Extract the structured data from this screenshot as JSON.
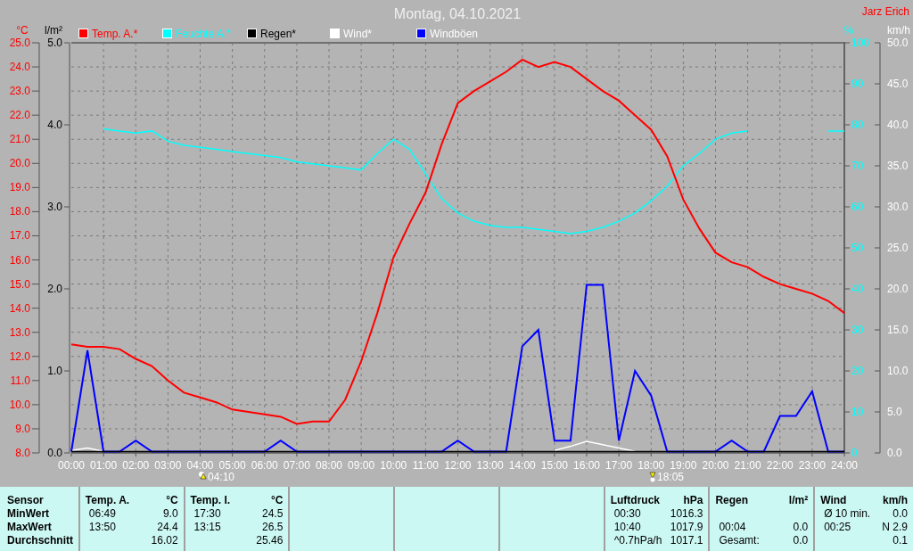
{
  "header": {
    "author": "Jarz Erich"
  },
  "chart": {
    "chart_data": {
      "type": "line",
      "title": "Montag, 04.10.2021",
      "legend": "top",
      "grid": true,
      "x": [
        0,
        0.5,
        1,
        1.5,
        2,
        2.5,
        3,
        3.5,
        4,
        4.5,
        5,
        5.5,
        6,
        6.5,
        7,
        7.5,
        8,
        8.5,
        9,
        9.5,
        10,
        10.5,
        11,
        11.5,
        12,
        12.5,
        13,
        13.5,
        14,
        14.5,
        15,
        15.5,
        16,
        16.5,
        17,
        17.5,
        18,
        18.5,
        19,
        19.5,
        20,
        20.5,
        21,
        21.5,
        22,
        22.5,
        23,
        23.5,
        24
      ],
      "xlim": [
        0,
        24
      ],
      "xticks": [
        {
          "value": 0,
          "label": "00:00"
        },
        {
          "value": 1,
          "label": "01:00"
        },
        {
          "value": 2,
          "label": "02:00"
        },
        {
          "value": 3,
          "label": "03:00"
        },
        {
          "value": 4,
          "label": "04:00"
        },
        {
          "value": 5,
          "label": "05:00"
        },
        {
          "value": 6,
          "label": "06:00"
        },
        {
          "value": 7,
          "label": "07:00"
        },
        {
          "value": 8,
          "label": "08:00"
        },
        {
          "value": 9,
          "label": "09:00"
        },
        {
          "value": 10,
          "label": "10:00"
        },
        {
          "value": 11,
          "label": "11:00"
        },
        {
          "value": 12,
          "label": "12:00"
        },
        {
          "value": 13,
          "label": "13:00"
        },
        {
          "value": 14,
          "label": "14:00"
        },
        {
          "value": 15,
          "label": "15:00"
        },
        {
          "value": 16,
          "label": "16:00"
        },
        {
          "value": 17,
          "label": "17:00"
        },
        {
          "value": 18,
          "label": "18:00"
        },
        {
          "value": 19,
          "label": "19:00"
        },
        {
          "value": 20,
          "label": "20:00"
        },
        {
          "value": 21,
          "label": "21:00"
        },
        {
          "value": 22,
          "label": "22:00"
        },
        {
          "value": 23,
          "label": "23:00"
        },
        {
          "value": 24,
          "label": "24:00"
        }
      ],
      "ylabel": "°C",
      "ylim": [
        8,
        25
      ],
      "yticks": [
        {
          "value": 8,
          "label": "8.0"
        },
        {
          "value": 9,
          "label": "9.0"
        },
        {
          "value": 10,
          "label": "10.0"
        },
        {
          "value": 11,
          "label": "11.0"
        },
        {
          "value": 12,
          "label": "12.0"
        },
        {
          "value": 13,
          "label": "13.0"
        },
        {
          "value": 14,
          "label": "14.0"
        },
        {
          "value": 15,
          "label": "15.0"
        },
        {
          "value": 16,
          "label": "16.0"
        },
        {
          "value": 17,
          "label": "17.0"
        },
        {
          "value": 18,
          "label": "18.0"
        },
        {
          "value": 19,
          "label": "19.0"
        },
        {
          "value": 20,
          "label": "20.0"
        },
        {
          "value": 21,
          "label": "21.0"
        },
        {
          "value": 22,
          "label": "22.0"
        },
        {
          "value": 23,
          "label": "23.0"
        },
        {
          "value": 24,
          "label": "24.0"
        },
        {
          "value": 25,
          "label": "25.0"
        }
      ],
      "y2label": "%",
      "y2lim": [
        0,
        100
      ],
      "y2ticks": [
        0,
        10,
        20,
        30,
        40,
        50,
        60,
        70,
        80,
        90,
        100
      ],
      "y3label": "km/h",
      "y3lim": [
        0,
        50
      ],
      "y3ticks": [
        {
          "value": 0,
          "label": "0.0"
        },
        {
          "value": 5,
          "label": "5.0"
        },
        {
          "value": 10,
          "label": "10.0"
        },
        {
          "value": 15,
          "label": "15.0"
        },
        {
          "value": 20,
          "label": "20.0"
        },
        {
          "value": 25,
          "label": "25.0"
        },
        {
          "value": 30,
          "label": "30.0"
        },
        {
          "value": 35,
          "label": "35.0"
        },
        {
          "value": 40,
          "label": "40.0"
        },
        {
          "value": 45,
          "label": "45.0"
        },
        {
          "value": 50,
          "label": "50.0"
        }
      ],
      "series": [
        {
          "name": "Temp. A.*",
          "color": "#ff0000",
          "values": [
            12.5,
            12.4,
            12.4,
            12.3,
            11.9,
            11.6,
            11.0,
            10.5,
            10.3,
            10.1,
            9.8,
            9.7,
            9.6,
            9.5,
            9.2,
            9.3,
            9.3,
            10.2,
            11.8,
            13.8,
            16.1,
            17.5,
            18.8,
            20.8,
            22.5,
            23.0,
            23.4,
            23.8,
            24.3,
            24.0,
            24.2,
            24.0,
            23.5,
            23.0,
            22.6,
            22.0,
            21.4,
            20.3,
            18.5,
            17.3,
            16.3,
            15.9,
            15.7,
            15.3,
            15.0,
            14.8,
            14.6,
            14.3,
            13.8
          ]
        },
        {
          "name": "Feuchte A.*",
          "color": "#00ffff",
          "axis": "y2",
          "values": [
            null,
            null,
            79,
            78.5,
            78,
            78.5,
            76,
            75,
            74.5,
            74,
            73.5,
            73,
            72.5,
            72,
            71,
            70.5,
            70,
            69.5,
            69,
            73,
            76.5,
            74,
            68,
            62,
            58.5,
            56.5,
            55.5,
            55,
            55,
            54.5,
            54,
            53.5,
            54,
            55,
            56.5,
            58.5,
            61.5,
            65,
            70,
            73,
            76.5,
            78,
            78.5,
            null,
            null,
            null,
            null,
            78.5,
            78.5
          ]
        },
        {
          "name": "Regen*",
          "color": "#000000",
          "axis": "y3",
          "values": [
            0,
            0,
            0,
            0,
            0,
            0,
            0,
            0,
            0,
            0,
            0,
            0,
            0,
            0,
            0,
            0,
            0,
            0,
            0,
            0,
            0,
            0,
            0,
            0,
            0,
            0,
            0,
            0,
            0,
            0,
            0,
            0,
            0,
            0,
            0,
            0,
            0,
            0,
            0,
            0,
            0,
            0,
            0,
            0,
            0,
            0,
            0,
            0,
            0
          ]
        },
        {
          "name": "Wind*",
          "color": "#ffffff",
          "axis": "y3",
          "values": [
            0.3,
            0.6,
            0.2,
            null,
            null,
            null,
            null,
            null,
            null,
            null,
            null,
            null,
            null,
            null,
            null,
            null,
            null,
            null,
            null,
            null,
            null,
            null,
            null,
            null,
            null,
            null,
            null,
            null,
            null,
            null,
            0.3,
            0.8,
            1.4,
            1.0,
            0.6,
            0.2,
            null,
            null,
            null,
            null,
            null,
            null,
            null,
            null,
            null,
            null,
            null,
            null,
            null
          ]
        },
        {
          "name": "Windböen",
          "color": "#0000ff",
          "axis": "y3",
          "values": [
            0,
            12.5,
            0,
            0,
            1.5,
            0,
            0,
            0,
            0,
            0,
            0,
            0,
            0,
            1.5,
            0,
            0,
            0,
            0,
            0,
            0,
            0,
            0,
            0,
            0,
            1.5,
            0,
            0,
            0,
            13,
            15,
            1.5,
            1.5,
            20.5,
            20.5,
            1.5,
            10,
            7,
            0,
            0,
            0,
            0,
            1.5,
            0,
            0,
            4.5,
            4.5,
            7.5,
            0,
            0
          ]
        }
      ]
    },
    "rain_axis": {
      "label": "l/m²",
      "ticks": [
        "5.0",
        "4.0",
        "3.0",
        "2.0",
        "1.0",
        "0.0"
      ]
    },
    "sun_times": [
      {
        "time": "04:10"
      },
      {
        "time": "18:05"
      }
    ]
  },
  "stats": {
    "row_labels": [
      "Sensor",
      "MinWert",
      "MaxWert",
      "Durchschnitt"
    ],
    "panels": [
      {
        "kind": "data",
        "title": "Temp. A.",
        "unit": "°C",
        "rows": [
          {
            "time": "06:49",
            "value": "9.0"
          },
          {
            "time": "13:50",
            "value": "24.4"
          },
          {
            "value": "16.02"
          }
        ]
      },
      {
        "kind": "data",
        "title": "Temp. I.",
        "unit": "°C",
        "rows": [
          {
            "time": "17:30",
            "value": "24.5"
          },
          {
            "time": "13:15",
            "value": "26.5"
          },
          {
            "value": "25.46"
          }
        ]
      },
      {
        "kind": "blank"
      },
      {
        "kind": "blank"
      },
      {
        "kind": "blank"
      },
      {
        "kind": "data",
        "title": "Luftdruck",
        "unit": "hPa",
        "rows": [
          {
            "time": "00:30",
            "value": "1016.3"
          },
          {
            "time": "10:40",
            "value": "1017.9"
          },
          {
            "time": "^0.7hPa/h",
            "value": "1017.1"
          }
        ]
      },
      {
        "kind": "data",
        "title": "Regen",
        "unit": "l/m²",
        "rows": [
          {},
          {
            "time": "00:04",
            "value": "0.0"
          },
          {
            "time": "Gesamt:",
            "value": "0.0"
          }
        ]
      },
      {
        "kind": "data",
        "title": "Wind",
        "unit": "km/h",
        "rows": [
          {
            "time": "Ø 10 min.",
            "value": "0.0"
          },
          {
            "time": "00:25",
            "value": "N 2.9"
          },
          {
            "value": "0.1"
          }
        ]
      }
    ]
  }
}
